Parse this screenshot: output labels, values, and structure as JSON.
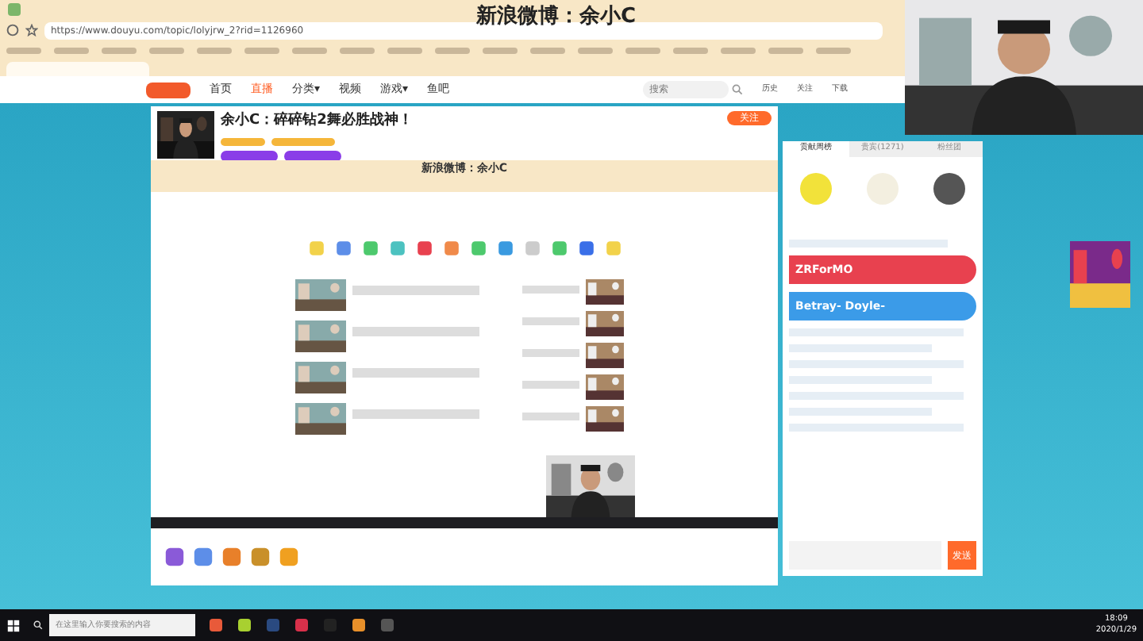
{
  "overlay_caption": "新浪微博：余小C",
  "browser": {
    "address": "https://www.douyu.com/topic/lolyjrw_2?rid=1126960"
  },
  "site_nav": {
    "items": [
      {
        "label": "首页",
        "selected": false
      },
      {
        "label": "直播",
        "selected": true
      },
      {
        "label": "分类▾",
        "selected": false
      },
      {
        "label": "视频",
        "selected": false
      },
      {
        "label": "游戏▾",
        "selected": false
      },
      {
        "label": "鱼吧",
        "selected": false
      }
    ],
    "search": {
      "placeholder": "搜索"
    },
    "user_icons": [
      {
        "label": "历史"
      },
      {
        "label": "关注"
      },
      {
        "label": "下载"
      }
    ]
  },
  "stream": {
    "title": "余小C：碎碎钻2舞必胜战神！",
    "follow_button": "关注",
    "nested_caption": "新浪微博：余小C"
  },
  "chat": {
    "tabs": [
      {
        "label": "贡献周榜",
        "selected": true
      },
      {
        "label": "贵宾(1271)",
        "selected": false
      },
      {
        "label": "粉丝团",
        "selected": false
      }
    ],
    "banners": [
      {
        "name": "ZRForMO",
        "color": "#e8414f"
      },
      {
        "name": "Betray- Doyle-",
        "color": "#3b9be8"
      }
    ],
    "send_button": "发送"
  },
  "taskbar": {
    "search_placeholder": "在这里输入你要搜索的内容",
    "time": "18:09",
    "date": "2020/1/29"
  }
}
